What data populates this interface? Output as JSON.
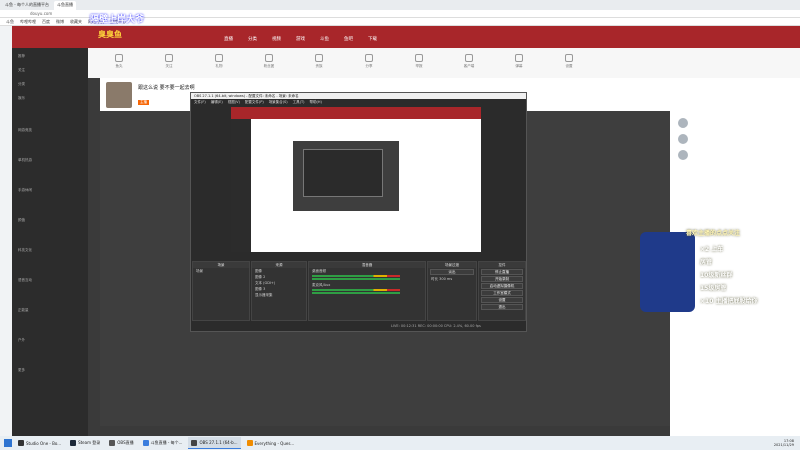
{
  "browser": {
    "tabs": [
      {
        "label": "斗鱼 - 每个人的直播平台"
      },
      {
        "label": "斗鱼直播",
        "active": true
      }
    ],
    "url": "douyu.com",
    "bookmarks": [
      "斗鱼",
      "哔哩哔哩",
      "百度",
      "微博",
      "收藏夹",
      "网站导航",
      "游戏中心"
    ]
  },
  "site_nav": {
    "banner_text": "隔壁上岸大爷",
    "banner_sub": "臭臭鱼",
    "items": [
      "直播",
      "分类",
      "视频",
      "游戏",
      "斗鱼",
      "鱼吧",
      "下载"
    ]
  },
  "sidebar": {
    "items": [
      "推荐",
      "关注",
      "分类",
      "娱乐",
      "网游竞技",
      "单机热游",
      "手游休闲",
      "颜值",
      "科技文化",
      "语音互动",
      "正能量",
      "户外",
      "更多"
    ]
  },
  "toolbar": {
    "tools": [
      "鱼丸",
      "关注",
      "礼物",
      "粉丝团",
      "贵族",
      "分享",
      "举报",
      "客户端",
      "弹幕",
      "设置"
    ]
  },
  "stream": {
    "title": "跟这么说 要不要一起去啊",
    "streamer_tag": "主播"
  },
  "obs": {
    "title": "OBS 27.1.1 (64-bit, windows) - 配置文件: 未命名 - 场景: 未命名",
    "menu": [
      "文件(F)",
      "编辑(E)",
      "视图(V)",
      "配置文件(P)",
      "场景集合(S)",
      "工具(T)",
      "帮助(H)"
    ],
    "docks": {
      "scenes": "场景",
      "sources": "来源",
      "mixer": "混音器",
      "transitions": "场景过渡",
      "controls": "控件"
    },
    "scene_list": [
      "场景"
    ],
    "source_list": [
      "图像",
      "图像 2",
      "文本 (GDI+)",
      "图像 3",
      "显示器采集"
    ],
    "mixer_tracks": [
      "桌面音频",
      "麦克风/Aux"
    ],
    "transition_value": "淡出",
    "duration_label": "时长",
    "duration_value": "300 ms",
    "controls": [
      "停止直播",
      "开始录制",
      "启动虚拟摄像机",
      "工作室模式",
      "设置",
      "退出"
    ],
    "status": "LIVE: 00:12:31  REC: 00:00:00  CPU: 2.4%, 60.00 fps"
  },
  "promo": {
    "header": "喜欢主播的点点关注",
    "lines": [
      "×2 上车",
      "房管",
      "10级新丝群",
      "15级房管",
      "×10 主播把屁股给你"
    ]
  },
  "taskbar": {
    "items": [
      "Studio One - Bo...",
      "Steam 登录",
      "OBS直播",
      "斗鱼直播 - 每个...",
      "OBS 27.1.1 (64-b...",
      "Everything - Ques..."
    ],
    "time": "17:08",
    "date": "2021/11/29"
  }
}
